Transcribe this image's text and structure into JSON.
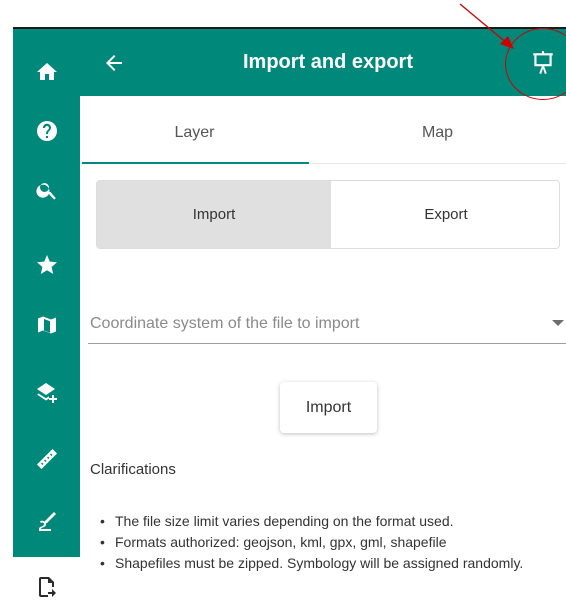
{
  "header": {
    "title": "Import and export",
    "back_icon": "arrow-left-icon",
    "present_icon": "presentation-icon",
    "background": "#00897b"
  },
  "sidebar": {
    "items": [
      {
        "icon": "home-icon"
      },
      {
        "icon": "help-icon"
      },
      {
        "icon": "search-icon"
      },
      {
        "icon": "star-icon"
      },
      {
        "icon": "map-icon"
      },
      {
        "icon": "add-layer-icon"
      },
      {
        "icon": "ruler-icon"
      },
      {
        "icon": "draw-icon"
      },
      {
        "icon": "file-export-icon",
        "active": true
      }
    ]
  },
  "tabs": [
    {
      "label": "Layer",
      "active": true
    },
    {
      "label": "Map",
      "active": false
    }
  ],
  "segmented": {
    "import_label": "Import",
    "export_label": "Export",
    "selected": "Import"
  },
  "coordinate_select": {
    "placeholder": "Coordinate system of the file to import"
  },
  "import_button": {
    "label": "Import"
  },
  "clarifications": {
    "title": "Clarifications",
    "items": [
      "The file size limit varies depending on the format used.",
      "Formats authorized: geojson, kml, gpx, gml, shapefile",
      "Shapefiles must be zipped. Symbology will be assigned randomly."
    ]
  },
  "annotation_color": "#d00000"
}
